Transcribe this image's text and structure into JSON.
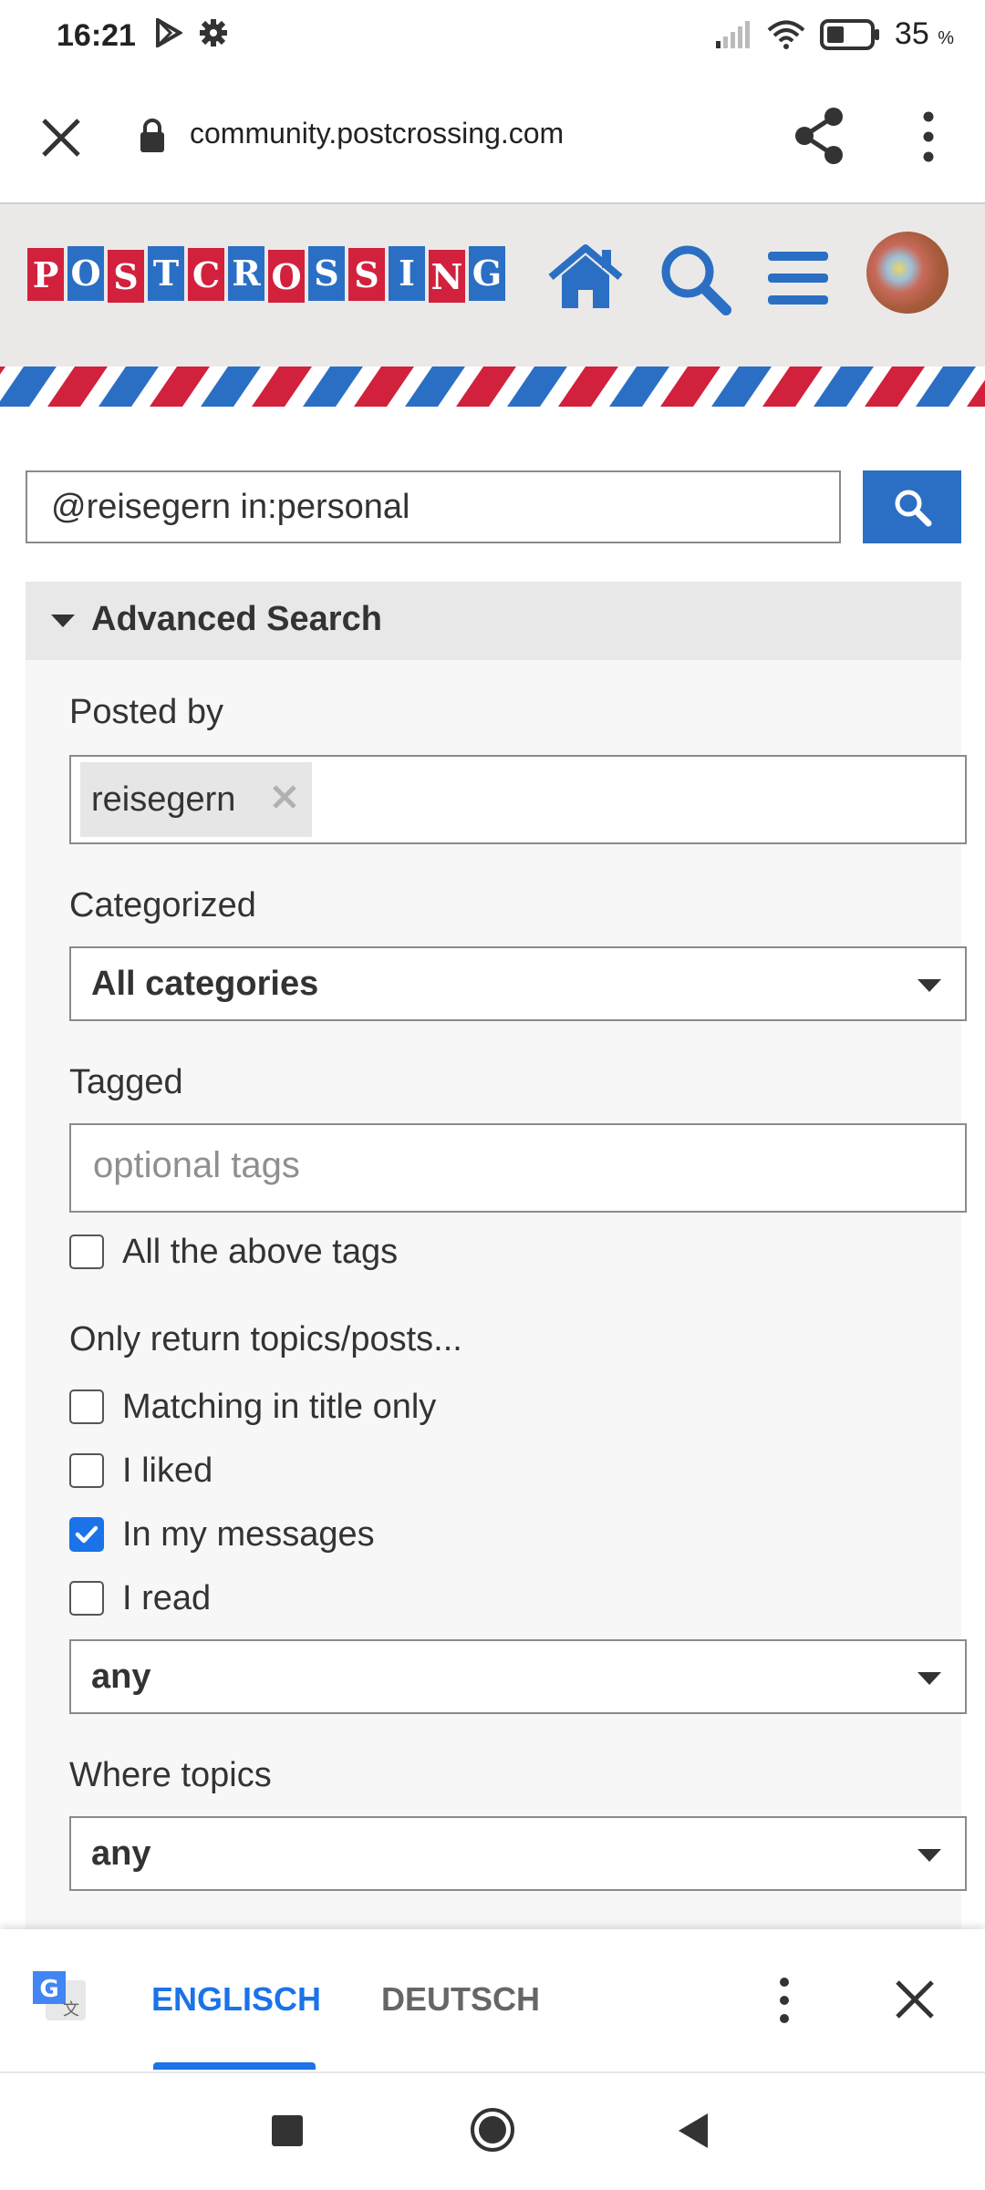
{
  "status_bar": {
    "time": "16:21",
    "battery_percent": "35",
    "battery_unit": "%",
    "icons": [
      "play-store-icon",
      "settings-gear-icon",
      "signal-icon",
      "wifi-icon",
      "battery-icon"
    ]
  },
  "browser": {
    "url": "community.postcrossing.com"
  },
  "site_header": {
    "logo_text": "POSTCROSSING",
    "accent_blue": "#2b6fc4",
    "accent_red": "#d1213d"
  },
  "search": {
    "query": "@reisegern in:personal"
  },
  "advanced_search": {
    "title": "Advanced Search",
    "posted_by": {
      "label": "Posted by",
      "chip": "reisegern"
    },
    "categorized": {
      "label": "Categorized",
      "value": "All categories"
    },
    "tagged": {
      "label": "Tagged",
      "placeholder": "optional tags",
      "all_tags_label": "All the above tags",
      "all_tags_checked": false
    },
    "only_return": {
      "label": "Only return topics/posts...",
      "options": [
        {
          "label": "Matching in title only",
          "checked": false
        },
        {
          "label": "I liked",
          "checked": false
        },
        {
          "label": "In my messages",
          "checked": true
        },
        {
          "label": "I read",
          "checked": false
        }
      ],
      "select_value": "any"
    },
    "where_topics": {
      "label": "Where topics",
      "value": "any"
    }
  },
  "translate_bar": {
    "tab_source": "ENGLISCH",
    "tab_target": "DEUTSCH",
    "active_tab": "ENGLISCH"
  }
}
